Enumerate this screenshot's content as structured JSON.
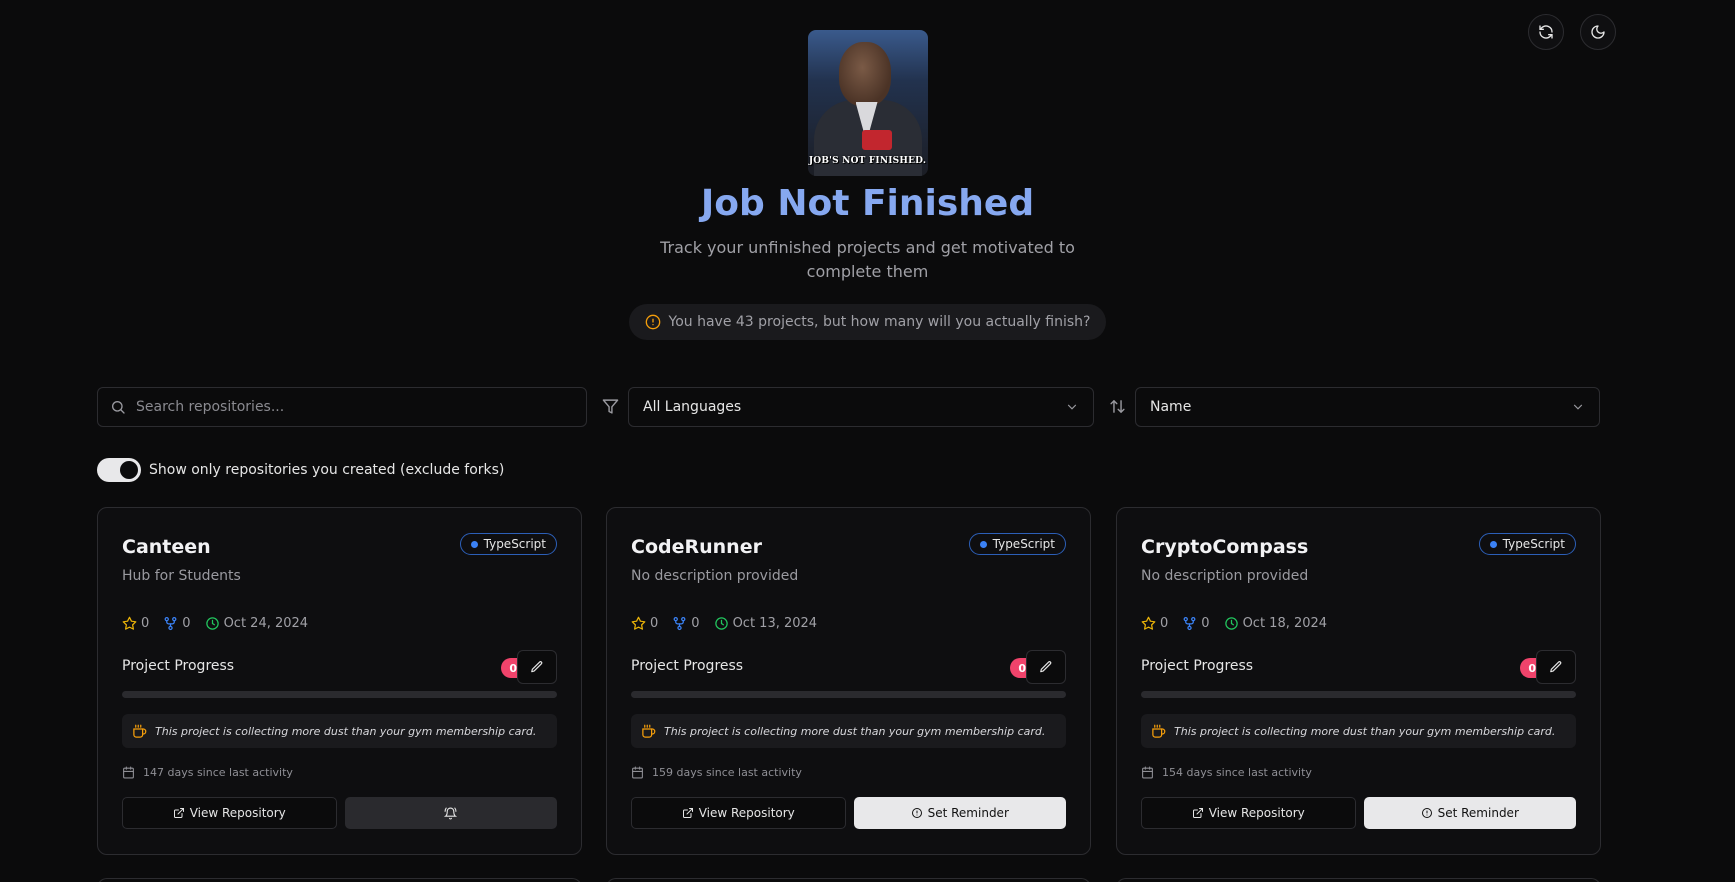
{
  "header": {
    "avatar_caption": "JOB'S NOT FINISHED.",
    "title": "Job Not Finished",
    "subtitle": "Track your unfinished projects and get motivated to complete them",
    "banner": "You have 43 projects, but how many will you actually finish?"
  },
  "toolbar": {
    "refresh_icon": "refresh-icon",
    "theme_icon": "moon-icon"
  },
  "controls": {
    "search_placeholder": "Search repositories...",
    "language_selected": "All Languages",
    "sort_selected": "Name"
  },
  "toggle": {
    "label": "Show only repositories you created (exclude forks)",
    "on": true
  },
  "colors": {
    "accent": "#86a8f0",
    "badge": "#f0436b",
    "star": "#eab308",
    "fork": "#3b82f6",
    "clock": "#22c55e",
    "quote_icon": "#f59e0b"
  },
  "cards": [
    {
      "name": "Canteen",
      "language": "TypeScript",
      "description": "Hub for Students",
      "stars": "0",
      "forks": "0",
      "updated": "Oct 24, 2024",
      "progress_label": "Project Progress",
      "progress_text": "0%",
      "progress": 0,
      "quote": "This project is collecting more dust than your gym membership card.",
      "days": "147 days since last activity",
      "view_label": "View Repository",
      "second_label": ""
    },
    {
      "name": "CodeRunner",
      "language": "TypeScript",
      "description": "No description provided",
      "stars": "0",
      "forks": "0",
      "updated": "Oct 13, 2024",
      "progress_label": "Project Progress",
      "progress_text": "0%",
      "progress": 0,
      "quote": "This project is collecting more dust than your gym membership card.",
      "days": "159 days since last activity",
      "view_label": "View Repository",
      "second_label": "Set Reminder"
    },
    {
      "name": "CryptoCompass",
      "language": "TypeScript",
      "description": "No description provided",
      "stars": "0",
      "forks": "0",
      "updated": "Oct 18, 2024",
      "progress_label": "Project Progress",
      "progress_text": "0%",
      "progress": 0,
      "quote": "This project is collecting more dust than your gym membership card.",
      "days": "154 days since last activity",
      "view_label": "View Repository",
      "second_label": "Set Reminder"
    }
  ]
}
